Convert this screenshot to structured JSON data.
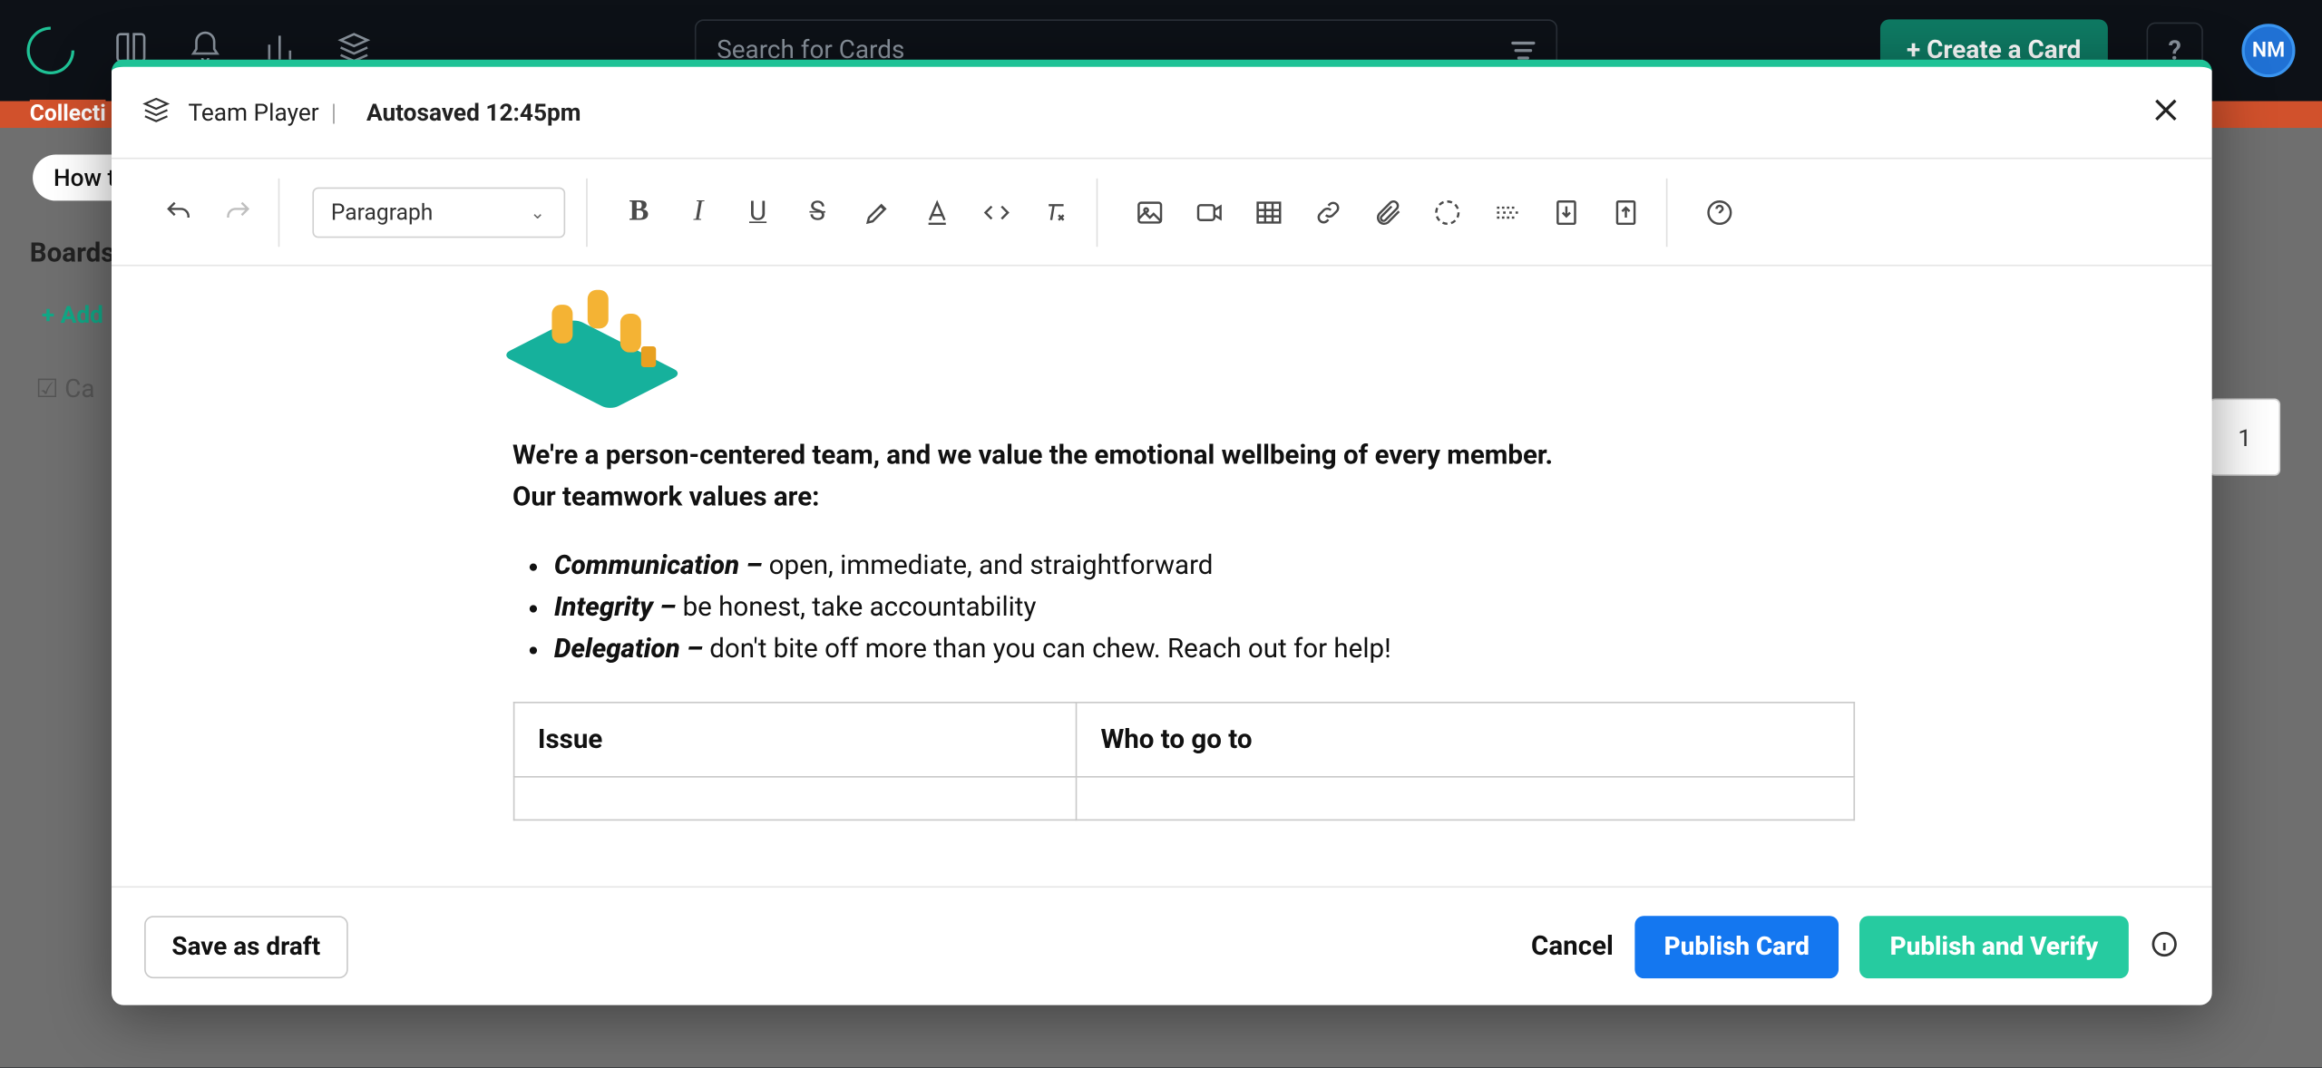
{
  "topbar": {
    "search_placeholder": "Search for Cards",
    "create_label": "+  Create a Card",
    "help": "?",
    "avatar": "NM"
  },
  "background": {
    "collections": "Collecti",
    "pill": "How t",
    "boards": "Boards",
    "add_board": "+  Add",
    "card_manager": "Ca",
    "counter": "1"
  },
  "modal": {
    "breadcrumb_board": "Team Player",
    "autosave": "Autosaved 12:45pm",
    "paragraph_label": "Paragraph",
    "intro_line1": "We're a person-centered team, and we value the emotional wellbeing of every member.",
    "intro_line2": "Our teamwork values are:",
    "values": [
      {
        "term": "Communication – ",
        "desc": "open, immediate, and straightforward"
      },
      {
        "term": "Integrity – ",
        "desc": "be honest, take accountability"
      },
      {
        "term": "Delegation – ",
        "desc": "don't bite off more than you can chew. Reach out for help!"
      }
    ],
    "table": {
      "h1": "Issue",
      "h2": "Who to go to"
    },
    "footer": {
      "save_draft": "Save as draft",
      "cancel": "Cancel",
      "publish": "Publish Card",
      "publish_verify": "Publish and Verify"
    }
  }
}
